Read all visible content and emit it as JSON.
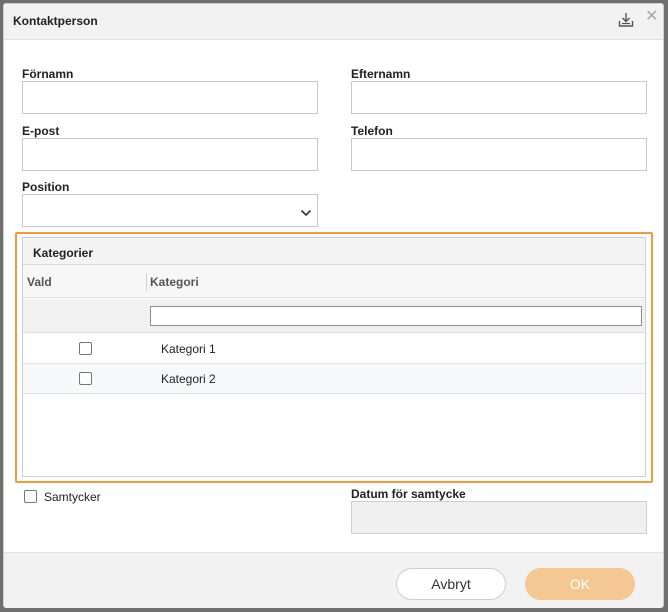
{
  "dialog": {
    "title": "Kontaktperson"
  },
  "form": {
    "fornamn_label": "Förnamn",
    "efternamn_label": "Efternamn",
    "epost_label": "E-post",
    "telefon_label": "Telefon",
    "position_label": "Position",
    "fornamn_value": "",
    "efternamn_value": "",
    "epost_value": "",
    "telefon_value": "",
    "position_value": ""
  },
  "categories": {
    "title": "Kategorier",
    "columns": [
      "Vald",
      "Kategori"
    ],
    "filter_value": "",
    "rows": [
      {
        "name": "Kategori 1",
        "selected": false
      },
      {
        "name": "Kategori 2",
        "selected": false
      }
    ]
  },
  "consent": {
    "samtycker_label": "Samtycker",
    "samtycker_checked": false,
    "datum_label": "Datum för samtycke",
    "datum_value": ""
  },
  "footer": {
    "cancel_label": "Avbryt",
    "ok_label": "OK"
  },
  "colors": {
    "highlight": "#f29b38",
    "ok_button": "#f5c793"
  },
  "icons": {
    "export": "export-icon",
    "close": "close-icon",
    "dropdown": "chevron-down-icon"
  }
}
